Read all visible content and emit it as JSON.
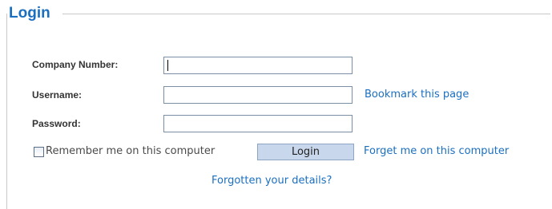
{
  "form": {
    "legend": "Login",
    "company_number": {
      "label": "Company Number:",
      "value": ""
    },
    "username": {
      "label": "Username:",
      "value": ""
    },
    "password": {
      "label": "Password:",
      "value": ""
    },
    "remember": {
      "label": "Remember me on this computer",
      "checked": false
    },
    "login_button": "Login"
  },
  "links": {
    "bookmark": "Bookmark this page",
    "forget": "Forget me on this computer",
    "forgotten": "Forgotten your details?"
  },
  "colors": {
    "accent": "#1a6fc1",
    "button_bg": "#c9d7ec",
    "label_text": "#333333"
  }
}
